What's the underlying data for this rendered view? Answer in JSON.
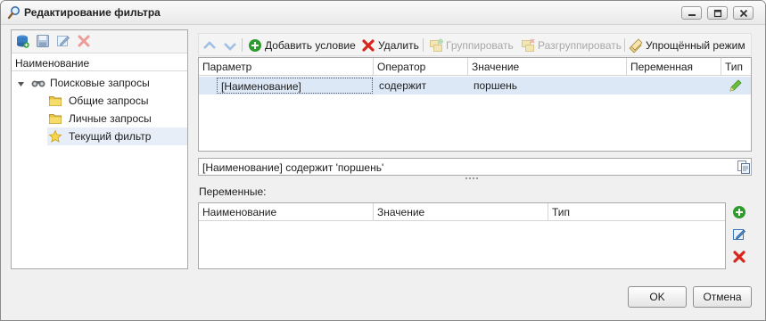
{
  "window": {
    "title": "Редактирование фильтра"
  },
  "left": {
    "header": "Наименование",
    "tree": [
      {
        "label": "Поисковые запросы",
        "level": 0
      },
      {
        "label": "Общие запросы",
        "level": 1
      },
      {
        "label": "Личные запросы",
        "level": 1
      },
      {
        "label": "Текущий фильтр",
        "level": 1,
        "selected": true
      }
    ]
  },
  "toolbar": {
    "add": "Добавить условие",
    "delete": "Удалить",
    "group": "Группировать",
    "ungroup": "Разгруппировать",
    "simple": "Упрощённый режим"
  },
  "conditions": {
    "columns": [
      "Параметр",
      "Оператор",
      "Значение",
      "Переменная",
      "Тип"
    ],
    "rows": [
      {
        "param": "[Наименование]",
        "op": "содержит",
        "value": "поршень",
        "variable": ""
      }
    ]
  },
  "expression": "[Наименование] содержит 'поршень'",
  "variables": {
    "label": "Переменные:",
    "columns": [
      "Наименование",
      "Значение",
      "Тип"
    ]
  },
  "buttons": {
    "ok": "OK",
    "cancel": "Отмена"
  },
  "colors": {
    "selection": "#dde8f7",
    "accent_green": "#2e9b2e",
    "accent_red": "#d9261c"
  }
}
